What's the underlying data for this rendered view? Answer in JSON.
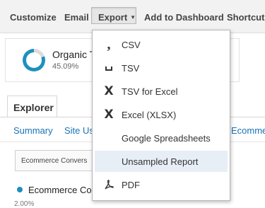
{
  "toolbar": {
    "customize": "Customize",
    "email": "Email",
    "export": "Export",
    "add_to_dashboard": "Add to Dashboard",
    "shortcut": "Shortcut"
  },
  "card": {
    "title": "Organic T",
    "percent": "45.09%",
    "donut_fraction": 0.45,
    "accent": "#1f8fbf"
  },
  "tabs": {
    "explorer": "Explorer"
  },
  "subtabs": [
    "Summary",
    "Site Us",
    "Ecomme"
  ],
  "metric_dropdown": "Ecommerce Convers",
  "legend": {
    "label": "Ecommerce Co"
  },
  "axis": {
    "top_value": "2.00%"
  },
  "export_menu": {
    "items": [
      {
        "label": "CSV",
        "icon": "comma-icon"
      },
      {
        "label": "TSV",
        "icon": "tsv-icon"
      },
      {
        "label": "TSV for Excel",
        "icon": "excel-x-icon"
      },
      {
        "label": "Excel (XLSX)",
        "icon": "excel-x-icon"
      },
      {
        "label": "Google Spreadsheets",
        "icon": "spreadsheet-grid-icon"
      },
      {
        "label": "Unsampled Report",
        "icon": "grid-icon"
      },
      {
        "label": "PDF",
        "icon": "pdf-icon"
      }
    ],
    "highlighted": "Unsampled Report",
    "highlight_color": "#e8eef6"
  }
}
